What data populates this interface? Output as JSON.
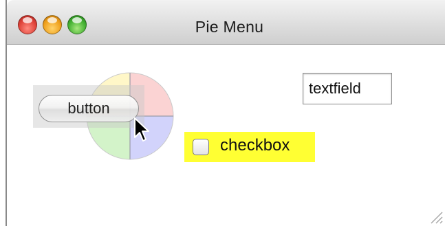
{
  "window": {
    "title": "Pie Menu"
  },
  "controls": {
    "button_label": "button",
    "checkbox_label": "checkbox",
    "checkbox_checked": false,
    "textfield_value": "textfield"
  },
  "pie_menu": {
    "sectors": [
      {
        "name": "top-left",
        "color": "#fff7c8"
      },
      {
        "name": "top-right",
        "color": "#fbd3d3"
      },
      {
        "name": "bottom-right",
        "color": "#d2d3fb"
      },
      {
        "name": "bottom-left",
        "color": "#d3f3c9"
      }
    ]
  },
  "colors": {
    "checkbox_highlight": "#ffff33"
  }
}
